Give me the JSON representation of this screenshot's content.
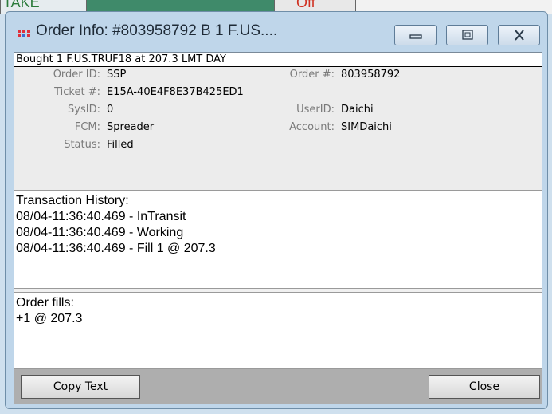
{
  "background": {
    "left_text": "TAKE",
    "mid_text": "Off"
  },
  "window": {
    "title": "Order Info: #803958792 B 1 F.US....",
    "controls": {
      "minimize": "minimize",
      "maximize": "maximize",
      "close": "close"
    }
  },
  "summary": "Bought 1 F.US.TRUF18 at 207.3 LMT DAY",
  "info": {
    "order_id_label": "Order ID:",
    "order_id": "SSP",
    "order_num_label": "Order #:",
    "order_num": "803958792",
    "ticket_label": "Ticket #:",
    "ticket": "E15A-40E4F8E37B425ED1",
    "sysid_label": "SysID:",
    "sysid": "0",
    "userid_label": "UserID:",
    "userid": "Daichi",
    "fcm_label": "FCM:",
    "fcm": "Spreader",
    "account_label": "Account:",
    "account": "SIMDaichi",
    "status_label": "Status:",
    "status": "Filled"
  },
  "history": {
    "title": "Transaction History:",
    "entries": [
      "08/04-11:36:40.469 - InTransit",
      "08/04-11:36:40.469 - Working",
      "08/04-11:36:40.469 - Fill 1 @ 207.3"
    ]
  },
  "fills": {
    "title": "Order fills:",
    "entries": [
      "+1 @ 207.3"
    ]
  },
  "buttons": {
    "copy": "Copy Text",
    "close": "Close"
  },
  "icons": {
    "app": "grid-app-icon",
    "accent": "#e0303a"
  }
}
